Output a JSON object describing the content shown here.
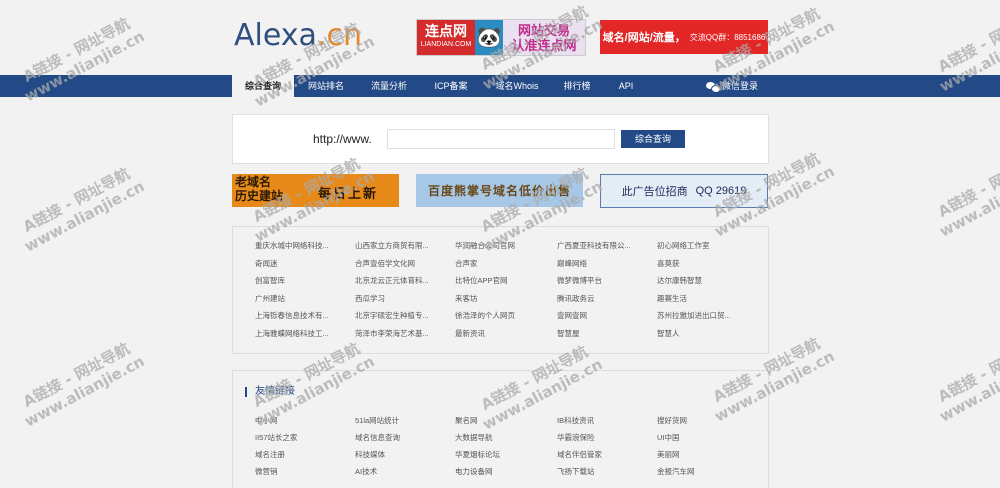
{
  "logo": {
    "part1": "Alexa",
    "part2": ".cn"
  },
  "ads": {
    "ad1": {
      "left_title": "连点网",
      "left_sub": "LIANDIAN.COM",
      "right_top": "网站交易",
      "right_bottom": "认准连点网"
    },
    "ad2": {
      "text": "域名/网站/流量，",
      "sub": "交流QQ群：8851686"
    }
  },
  "nav": {
    "items": [
      "综合查询",
      "网站排名",
      "流量分析",
      "ICP备案",
      "域名Whois",
      "排行榜",
      "API"
    ],
    "wechat_login": "微信登录"
  },
  "search": {
    "prefix": "http://www.",
    "placeholder": "",
    "button": "综合查询"
  },
  "banners": {
    "b1_line1": "老域名",
    "b1_line2": "历史建站",
    "b1_right": "每日上新",
    "b2": "百度熊掌号域名低价出售",
    "b3_label": "此广告位招商",
    "b3_qq": "QQ 29619"
  },
  "links": [
    [
      "重庆水城中网络科技...",
      "山西家立方商贸有限...",
      "华润融合公司官网",
      "广西夏亚科技有限公...",
      "初心网络工作室"
    ],
    [
      "奇闻迷",
      "合声壹佰学文化网",
      "合声家",
      "巅峰网络",
      "喜莫获"
    ],
    [
      "创富智库",
      "北京龙云正元体育科...",
      "比特位APP官网",
      "微梦微博平台",
      "达尔康韩智慧"
    ],
    [
      "广州建站",
      "西瓜学习",
      "来客坊",
      "腾讯政务云",
      "趣赛生活"
    ],
    [
      "上海铄春信息技术有...",
      "北京宇硕宏生种植专...",
      "徐浩泽的个人网页",
      "壹网壹网",
      "苏州拉雅加进出口贸..."
    ],
    [
      "上海雅蝶网络科技工...",
      "菏泽市李荣海艺术基...",
      "最新资讯",
      "智慧屋",
      "智慧人"
    ]
  ],
  "friend": {
    "title": "友情链接",
    "rows": [
      [
        "中小网",
        "51la网站统计",
        "聚名网",
        "IB科技资讯",
        "搜好货网"
      ],
      [
        "II57站长之家",
        "域名信息查询",
        "大数据导航",
        "华霸浪保险",
        "UI中国"
      ],
      [
        "域名注册",
        "科技媒体",
        "华夏烟标论坛",
        "域名伴侣管家",
        "美丽网"
      ],
      [
        "微营销",
        "AI技术",
        "电力设备网",
        "飞扬下载站",
        "金报汽车网"
      ]
    ]
  },
  "watermark": {
    "line1": "A链接 - 网址导航",
    "line2": "www.alianjie.cn"
  }
}
